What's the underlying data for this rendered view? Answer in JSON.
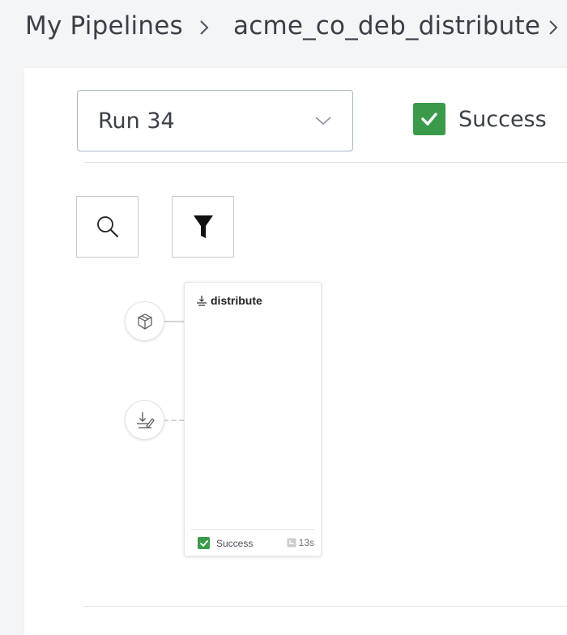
{
  "breadcrumb": {
    "root": "My Pipelines",
    "pipeline": "acme_co_deb_distribute",
    "separator_icon": "chevron-right-icon"
  },
  "run": {
    "selected": "Run 34",
    "dropdown_icon": "chevron-down-icon",
    "status": "Success",
    "status_color": "#3a9a4a"
  },
  "toolbar": {
    "search_icon": "search-icon",
    "filter_icon": "filter-icon"
  },
  "graph": {
    "input_nodes": [
      {
        "icon": "package-icon"
      },
      {
        "icon": "distribute-icon"
      }
    ],
    "steps": [
      {
        "name": "distribute",
        "status": "Success",
        "duration": "13s"
      }
    ]
  }
}
